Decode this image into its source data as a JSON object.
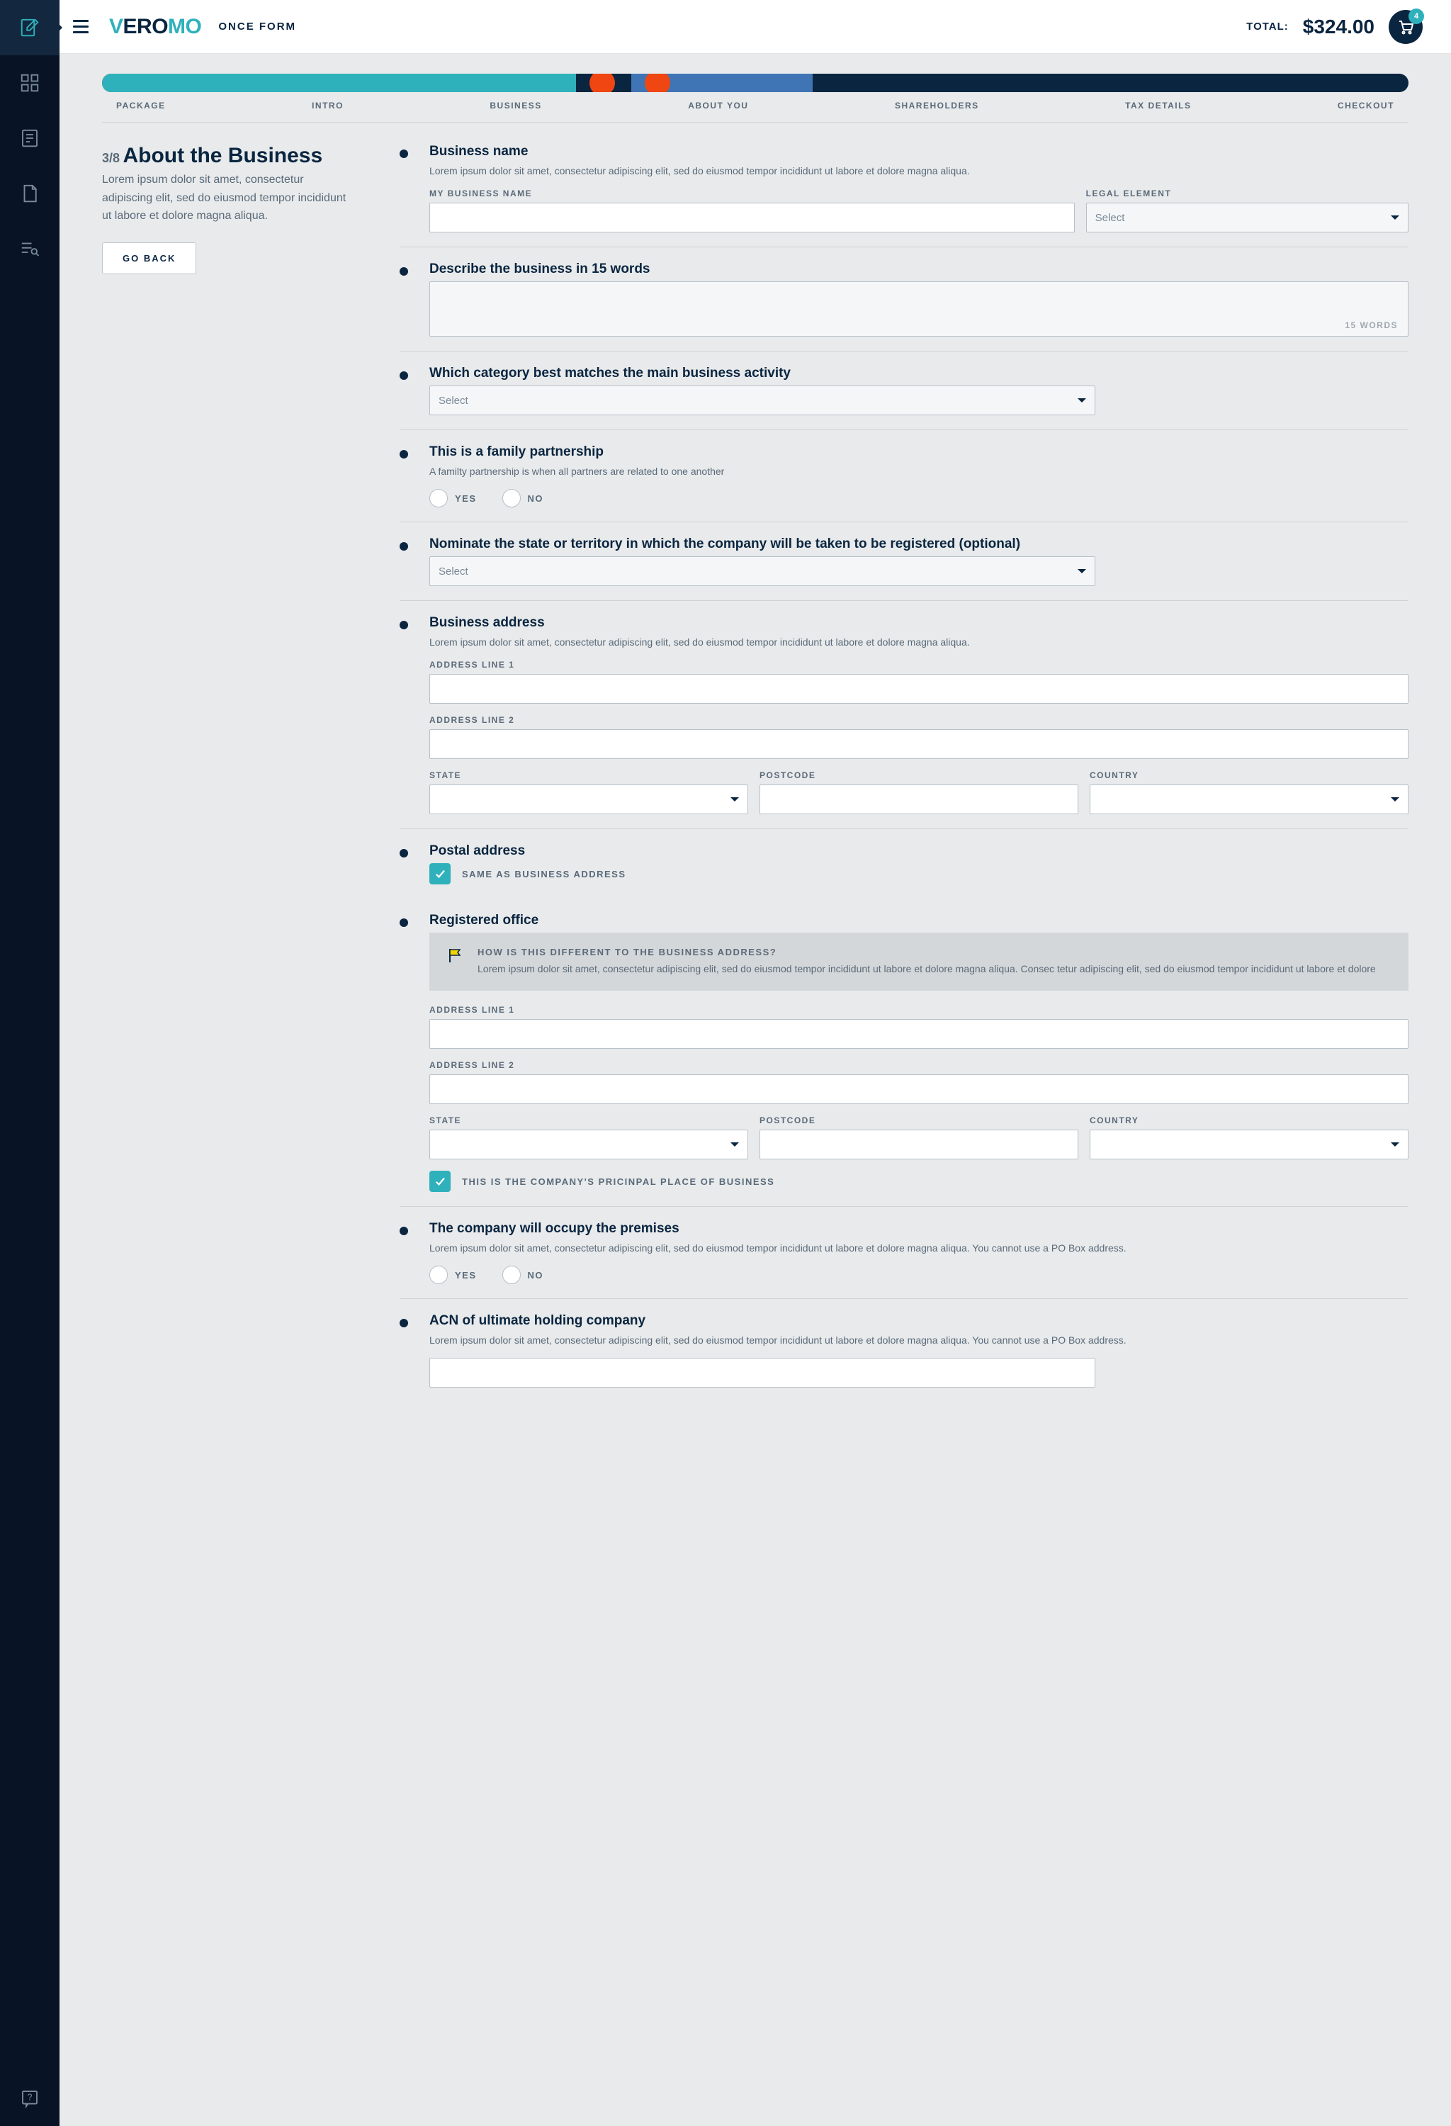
{
  "brand": {
    "prefix": "V",
    "mid": "ERO",
    "suffix": "MO",
    "tagline": "ONCE FORM"
  },
  "header": {
    "total_label": "TOTAL:",
    "total_amount": "$324.00",
    "cart_count": "4"
  },
  "steps": [
    "PACKAGE",
    "INTRO",
    "BUSINESS",
    "ABOUT YOU",
    "SHAREHOLDERS",
    "TAX DETAILS",
    "CHECKOUT"
  ],
  "left": {
    "counter": "3/8",
    "title": "About the Business",
    "desc": "Lorem ipsum dolor sit amet, consectetur adipiscing elit, sed do eiusmod tempor incididunt ut labore et dolore magna aliqua.",
    "back": "GO BACK"
  },
  "biz_name": {
    "title": "Business name",
    "desc": "Lorem ipsum dolor sit amet, consectetur adipiscing elit, sed do eiusmod tempor incididunt ut labore et dolore magna aliqua.",
    "label_name": "MY BUSINESS NAME",
    "label_legal": "LEGAL ELEMENT",
    "select_placeholder": "Select"
  },
  "describe": {
    "title": "Describe the business in 15 words",
    "count": "15 WORDS"
  },
  "category": {
    "title": "Which category best matches the main business activity",
    "placeholder": "Select"
  },
  "family": {
    "title": "This is a family partnership",
    "desc": "A familty partnership is when all partners are related to one another",
    "yes": "YES",
    "no": "NO"
  },
  "state_nom": {
    "title": "Nominate the state or territory in which the company will be taken to be registered (optional)",
    "placeholder": "Select"
  },
  "biz_addr": {
    "title": "Business address",
    "desc": "Lorem ipsum dolor sit amet, consectetur adipiscing elit, sed do eiusmod tempor incididunt ut labore et dolore magna aliqua.",
    "line1": "ADDRESS LINE 1",
    "line2": "ADDRESS LINE 2",
    "state": "STATE",
    "postcode": "POSTCODE",
    "country": "COUNTRY"
  },
  "postal": {
    "title": "Postal address",
    "same": "SAME AS BUSINESS ADDRESS"
  },
  "registered": {
    "title": "Registered office",
    "info_title": "HOW IS THIS DIFFERENT TO THE BUSINESS ADDRESS?",
    "info_text": "Lorem ipsum dolor sit amet, consectetur adipiscing elit, sed do eiusmod tempor incididunt ut labore et dolore magna aliqua. Consec tetur adipiscing elit, sed do eiusmod tempor incididunt ut labore et dolore",
    "line1": "ADDRESS LINE 1",
    "line2": "ADDRESS LINE 2",
    "state": "STATE",
    "postcode": "POSTCODE",
    "country": "COUNTRY",
    "principal": "THIS IS THE COMPANY'S PRICINPAL PLACE OF BUSINESS"
  },
  "occupy": {
    "title": "The company will occupy the premises",
    "desc": "Lorem ipsum dolor sit amet, consectetur adipiscing elit, sed do eiusmod tempor incididunt ut labore et dolore magna aliqua. You cannot use a PO Box address.",
    "yes": "YES",
    "no": "NO"
  },
  "acn": {
    "title": "ACN of ultimate holding company",
    "desc": "Lorem ipsum dolor sit amet, consectetur adipiscing elit, sed do eiusmod tempor incididunt ut labore et dolore magna aliqua. You cannot use a PO Box address."
  }
}
